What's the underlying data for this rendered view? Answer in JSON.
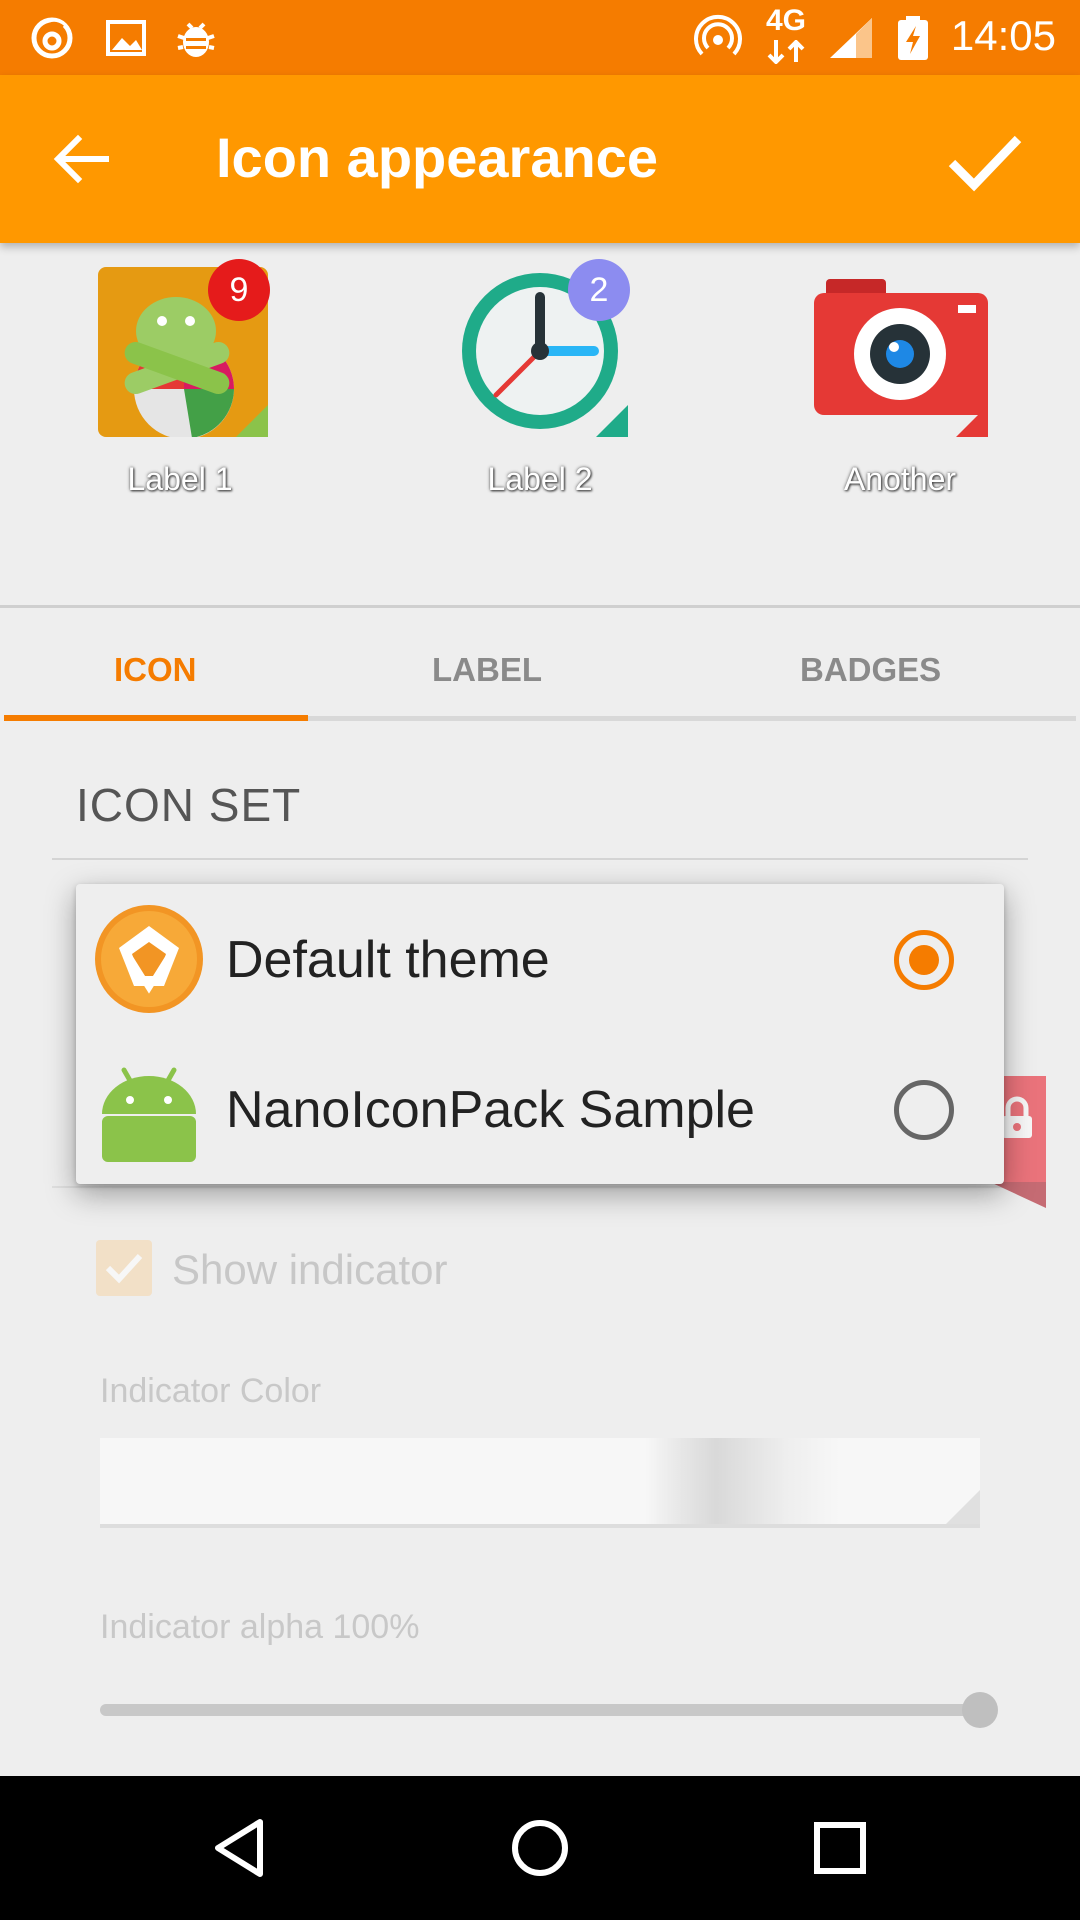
{
  "status_bar": {
    "network": "4G",
    "time": "14:05"
  },
  "toolbar": {
    "title": "Icon appearance"
  },
  "preview": {
    "items": [
      {
        "label": "Label 1",
        "badge": "9",
        "badge_color": "#e53935"
      },
      {
        "label": "Label 2",
        "badge": "2",
        "badge_color": "#8c8cf0"
      },
      {
        "label": "Another"
      }
    ]
  },
  "tabs": [
    {
      "label": "ICON",
      "selected": true
    },
    {
      "label": "LABEL",
      "selected": false
    },
    {
      "label": "BADGES",
      "selected": false
    }
  ],
  "icon_set": {
    "title": "ICON SET",
    "options": [
      {
        "label": "Default theme",
        "selected": true
      },
      {
        "label": "NanoIconPack Sample",
        "selected": false
      }
    ]
  },
  "indicator": {
    "show_label": "Show indicator",
    "show_checked": true,
    "color_label": "Indicator Color",
    "alpha_label": "Indicator alpha 100%",
    "alpha_value": 1.0
  },
  "colors": {
    "accent": "#f57c00",
    "toolbar": "#ff9800"
  }
}
